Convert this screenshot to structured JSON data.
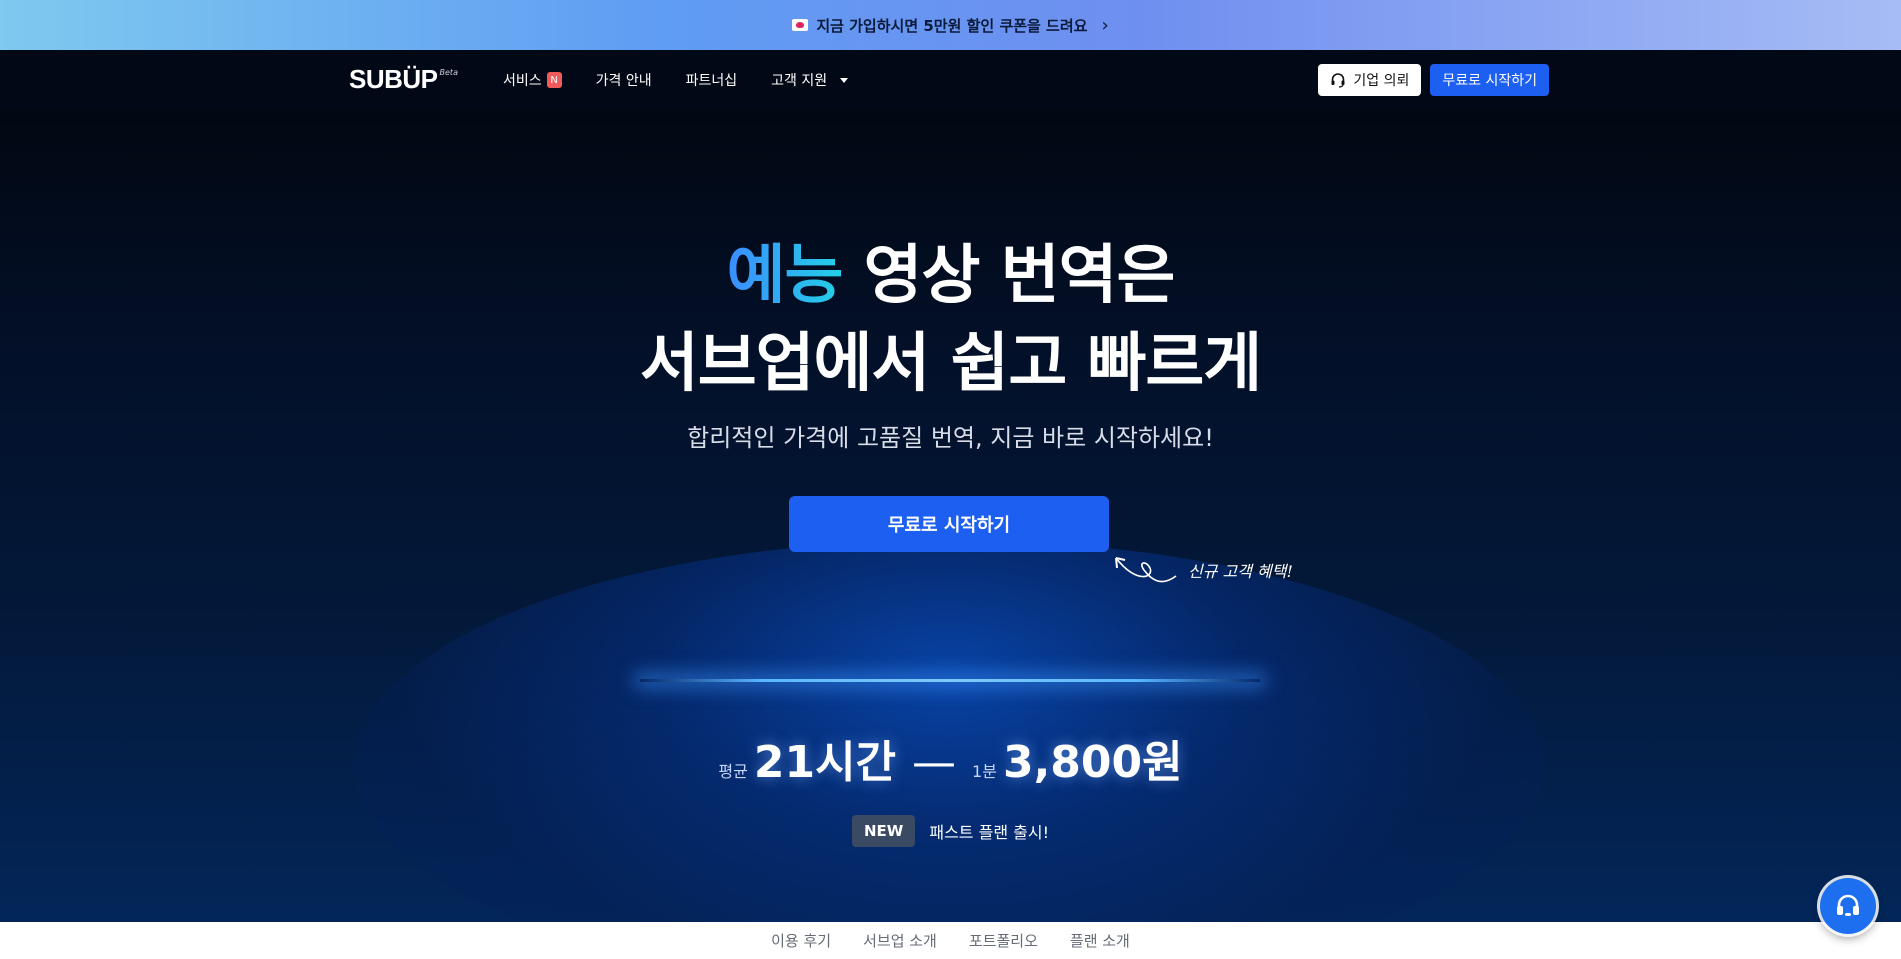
{
  "promo": {
    "text": "지금 가입하시면 5만원 할인 쿠폰을 드려요",
    "chevron": "›"
  },
  "nav": {
    "logo": "SUBÜP",
    "logo_badge": "Beta",
    "items": [
      {
        "label": "서비스",
        "badge": "N"
      },
      {
        "label": "가격 안내"
      },
      {
        "label": "파트너십"
      },
      {
        "label": "고객 지원",
        "dropdown": true
      }
    ],
    "inquiry_label": "기업 의뢰",
    "start_label": "무료로 시작하기"
  },
  "hero": {
    "title_accent": "예능",
    "title_rest": " 영상 번역은",
    "title_line2": "서브업에서 쉽고 빠르게",
    "subtitle": "합리적인 가격에 고품질 번역, 지금 바로 시작하세요!",
    "cta_label": "무료로 시작하기",
    "note": "신규 고객 혜택!",
    "stats": {
      "avg_label": "평균",
      "avg_value": "21시간",
      "dash": "—",
      "per_label": "1분",
      "price": "3,800원"
    },
    "new_tag": "NEW",
    "new_text": "패스트 플랜 출시!"
  },
  "tabs": [
    "이용 후기",
    "서브업 소개",
    "포트폴리오",
    "플랜 소개"
  ],
  "colors": {
    "primary": "#1d5ff0",
    "badge": "#ef5a5a",
    "accent_gradient_start": "#3b8dff",
    "accent_gradient_end": "#23d0e6"
  },
  "icons": {
    "promo": "envelope-heart-icon",
    "inquiry": "headset-icon",
    "help": "headset-icon",
    "note_arrow": "curly-arrow-icon"
  }
}
